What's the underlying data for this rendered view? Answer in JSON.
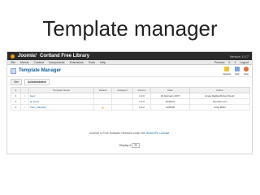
{
  "slide": {
    "title": "Template manager"
  },
  "header": {
    "logo": "Joomla!",
    "site_name": "Cortland Free Library",
    "version": "Version 1.0.7"
  },
  "menu": {
    "items": [
      "Site",
      "Menus",
      "Content",
      "Components",
      "Extensions",
      "Tools",
      "Help"
    ],
    "right": [
      "Preview",
      "0",
      "1",
      "Logout"
    ]
  },
  "toolbar": {
    "title": "Template Manager",
    "buttons": [
      "Default",
      "Edit",
      "Help"
    ]
  },
  "tabs": [
    "Site",
    "Administrator"
  ],
  "table": {
    "headers": [
      "#",
      "",
      "Template Name",
      "Default",
      "Assigned",
      "Version",
      "Date",
      "Author"
    ],
    "rows": [
      {
        "num": "1",
        "name": "beez",
        "default": "",
        "version": "1.0.0",
        "date": "19 February 2007",
        "author": "Angie Radtke/Robert Deutz"
      },
      {
        "num": "2",
        "name": "ja_purity",
        "default": "",
        "version": "1.2.0",
        "date": "12/26/07",
        "author": "JoomlArt.com"
      },
      {
        "num": "3",
        "name": "rhuk_milkyway",
        "default": "★",
        "version": "1.0.2",
        "date": "11/20/06",
        "author": "Andy Miller"
      }
    ]
  },
  "footer": {
    "text": "Joomla! is Free Software released under the",
    "link": "GNU/GPL License."
  },
  "display": {
    "label": "Display #",
    "value": "20"
  }
}
